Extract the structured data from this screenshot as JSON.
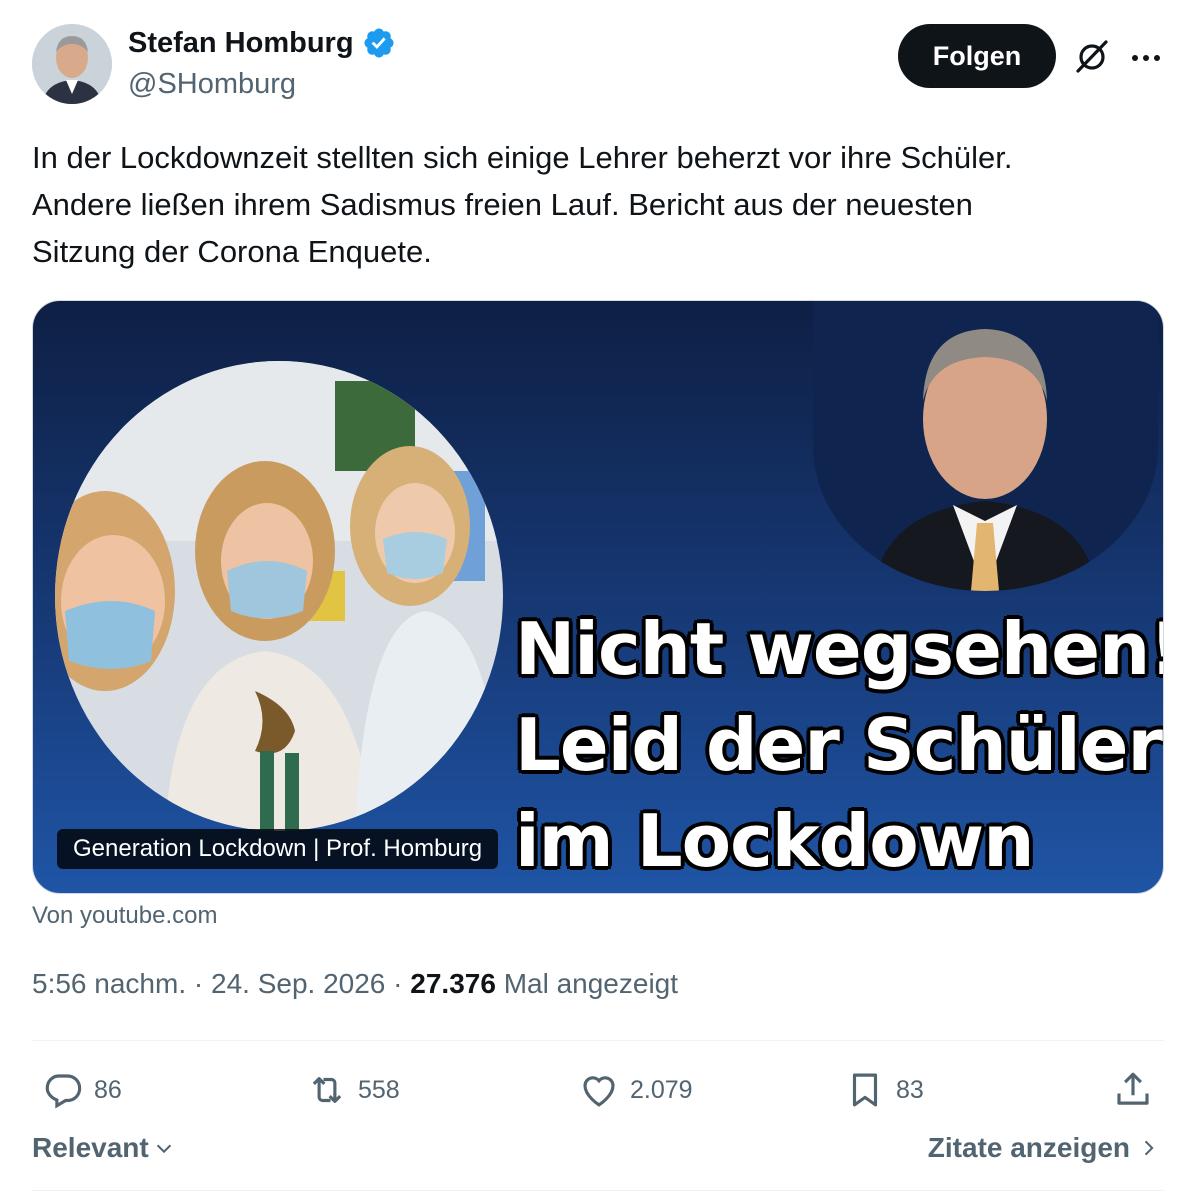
{
  "author": {
    "display_name": "Stefan Homburg",
    "handle": "@SHomburg",
    "verified_icon": "verified-badge-icon"
  },
  "follow_label": "Folgen",
  "tweet": {
    "lines": [
      "In der Lockdownzeit stellten sich einige Lehrer beherzt vor ihre Schüler.",
      "Andere ließen ihrem Sadismus freien Lauf. Bericht aus der neuesten",
      "Sitzung der Corona Enquete."
    ]
  },
  "media": {
    "headline_lines": [
      "Nicht wegsehen!",
      "Leid der Schüler",
      "im Lockdown"
    ],
    "caption": "Generation Lockdown | Prof. Homburg",
    "source": "Von youtube.com"
  },
  "meta": {
    "time": "5:56 nachm.",
    "separator": "·",
    "date": "24. Sep. 2026",
    "views_count": "27.376",
    "views_label": "Mal angezeigt"
  },
  "actions": {
    "replies": "86",
    "reposts": "558",
    "likes": "2.079",
    "bookmarks": "83"
  },
  "footer": {
    "sort_label": "Relevant",
    "quotes_label": "Zitate anzeigen"
  },
  "colors": {
    "accent": "#1d9bf0",
    "text_primary": "#0f1419",
    "text_secondary": "#536471",
    "media_bg_top": "#0e1f44",
    "media_bg_bottom": "#1f55a6"
  }
}
